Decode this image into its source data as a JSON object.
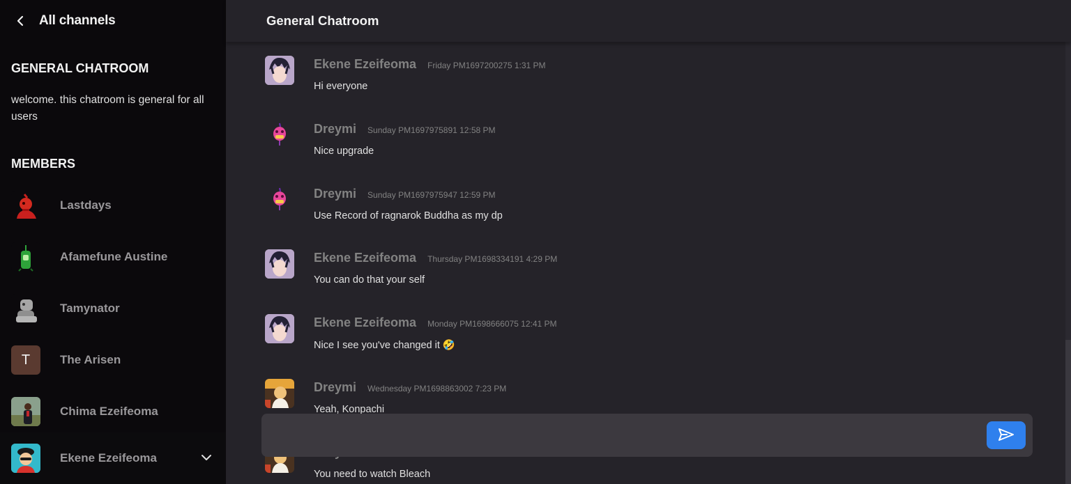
{
  "sidebar": {
    "back_label": "All channels",
    "channel_name": "GENERAL CHATROOM",
    "channel_description": "welcome. this chatroom is general for all users",
    "members_title": "MEMBERS",
    "members": [
      {
        "name": "Lastdays",
        "avatar": "red-character-avatar"
      },
      {
        "name": "Afamefune Austine",
        "avatar": "green-character-avatar"
      },
      {
        "name": "Tamynator",
        "avatar": "grey-robot-avatar"
      },
      {
        "name": "The Arisen",
        "avatar": "letter-avatar",
        "initial": "T",
        "color": "#5a3a30"
      },
      {
        "name": "Chima Ezeifeoma",
        "avatar": "photo-avatar"
      }
    ],
    "current_user": {
      "name": "Ekene Ezeifeoma",
      "avatar": "cap-character-avatar"
    }
  },
  "header": {
    "title": "General Chatroom"
  },
  "messages": [
    {
      "author": "Ekene Ezeifeoma",
      "time": "Friday PM1697200275 1:31 PM",
      "text": "Hi everyone",
      "avatar": "anime-avatar"
    },
    {
      "author": "Dreymi",
      "time": "Sunday PM1697975891 12:58 PM",
      "text": "Nice upgrade",
      "avatar": "pink-mascot-avatar"
    },
    {
      "author": "Dreymi",
      "time": "Sunday PM1697975947 12:59 PM",
      "text": "Use Record of ragnarok Buddha as my dp",
      "avatar": "pink-mascot-avatar"
    },
    {
      "author": "Ekene Ezeifeoma",
      "time": "Thursday PM1698334191 4:29 PM",
      "text": "You can do that your self",
      "avatar": "anime-avatar"
    },
    {
      "author": "Ekene Ezeifeoma",
      "time": "Monday PM1698666075 12:41 PM",
      "text": "Nice I see you've changed it 🤣",
      "avatar": "anime-avatar"
    },
    {
      "author": "Dreymi",
      "time": "Wednesday PM1698863002 7:23 PM",
      "text": "Yeah, Konpachi",
      "avatar": "buddha-avatar"
    },
    {
      "author": "Dreymi",
      "time": "",
      "text": "You need to watch Bleach",
      "avatar": "buddha-avatar"
    }
  ],
  "composer": {
    "placeholder": "",
    "value": ""
  },
  "colors": {
    "accent": "#2f80ed",
    "sidebar_bg": "#0b090c",
    "main_bg": "#252329",
    "input_bg": "#3c393f",
    "muted": "#828282"
  }
}
